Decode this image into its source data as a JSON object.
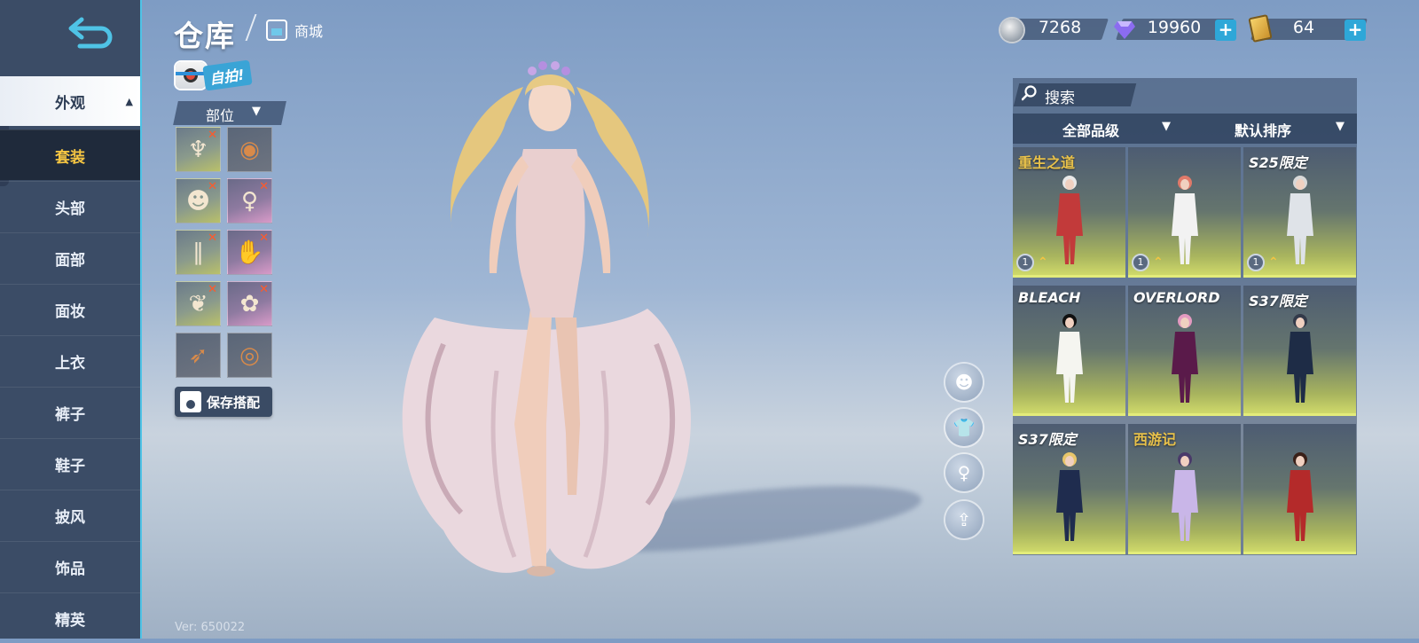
{
  "sidebar": {
    "category": "外观",
    "items": [
      "套装",
      "头部",
      "面部",
      "面妆",
      "上衣",
      "裤子",
      "鞋子",
      "披风",
      "饰品",
      "精英"
    ],
    "active_index": 0
  },
  "header": {
    "title": "仓库",
    "store_link": "商城"
  },
  "currencies": [
    {
      "name": "silver-coin",
      "value": "7268"
    },
    {
      "name": "diamond",
      "value": "19960"
    },
    {
      "name": "ticket",
      "value": "64"
    }
  ],
  "selfie": {
    "label": "自拍!"
  },
  "parts": {
    "dropdown_label": "部位",
    "slots": [
      {
        "icon": "hair-item-icon",
        "style": "gold",
        "equipped": true,
        "glyph": "♆"
      },
      {
        "icon": "mask-slot-icon",
        "style": "dark",
        "equipped": false,
        "glyph": "◉"
      },
      {
        "icon": "face-item-icon",
        "style": "gold",
        "equipped": true,
        "glyph": "☻"
      },
      {
        "icon": "bodysuit-item-icon",
        "style": "pink",
        "equipped": true,
        "glyph": "♀"
      },
      {
        "icon": "leg-item-icon",
        "style": "gold",
        "equipped": true,
        "glyph": "∥"
      },
      {
        "icon": "glove-item-icon",
        "style": "pink",
        "equipped": true,
        "glyph": "✋"
      },
      {
        "icon": "feather-cape-icon",
        "style": "gold",
        "equipped": true,
        "glyph": "❦"
      },
      {
        "icon": "flower-crown-icon",
        "style": "pink",
        "equipped": true,
        "glyph": "✿"
      },
      {
        "icon": "wing-slot-icon",
        "style": "dark",
        "equipped": false,
        "glyph": "➶"
      },
      {
        "icon": "ring-slot-icon",
        "style": "dark",
        "equipped": false,
        "glyph": "◎"
      }
    ],
    "save_label": "保存搭配"
  },
  "version": "Ver: 650022",
  "search": {
    "label": "搜索"
  },
  "filters": {
    "quality": "全部品级",
    "sort": "默认排序"
  },
  "costumes": [
    {
      "label": "重生之道",
      "label_style": "gold",
      "badge": true,
      "star": "1",
      "color": "#c23a3a",
      "hair": "#e8e8e8"
    },
    {
      "label": "",
      "label_style": "",
      "badge": true,
      "star": "1",
      "color": "#f2f2f2",
      "hair": "#e07a6a"
    },
    {
      "label": "S25限定",
      "label_style": "",
      "badge": true,
      "star": "1",
      "color": "#dfe3e8",
      "hair": "#d8d8d8"
    },
    {
      "label": "BLEACH",
      "label_style": "",
      "badge": false,
      "star": "",
      "color": "#f5f5f0",
      "hair": "#111111"
    },
    {
      "label": "OVERLORD",
      "label_style": "",
      "badge": false,
      "star": "",
      "color": "#5a1a4a",
      "hair": "#e39ac0"
    },
    {
      "label": "S37限定",
      "label_style": "",
      "badge": false,
      "star": "",
      "color": "#1e2c46",
      "hair": "#333a4a"
    },
    {
      "label": "S37限定",
      "label_style": "",
      "badge": false,
      "star": "",
      "color": "#1f2c4e",
      "hair": "#e8c66a"
    },
    {
      "label": "西游记",
      "label_style": "gold",
      "badge": false,
      "star": "",
      "color": "#c9b6e8",
      "hair": "#4a3a6a"
    },
    {
      "label": "",
      "label_style": "",
      "badge": false,
      "star": "",
      "color": "#b42a2a",
      "hair": "#3a2018"
    }
  ],
  "colors": {
    "accent": "#4fc3e6",
    "active_text": "#f5c542",
    "plus": "#2ea7d8"
  }
}
